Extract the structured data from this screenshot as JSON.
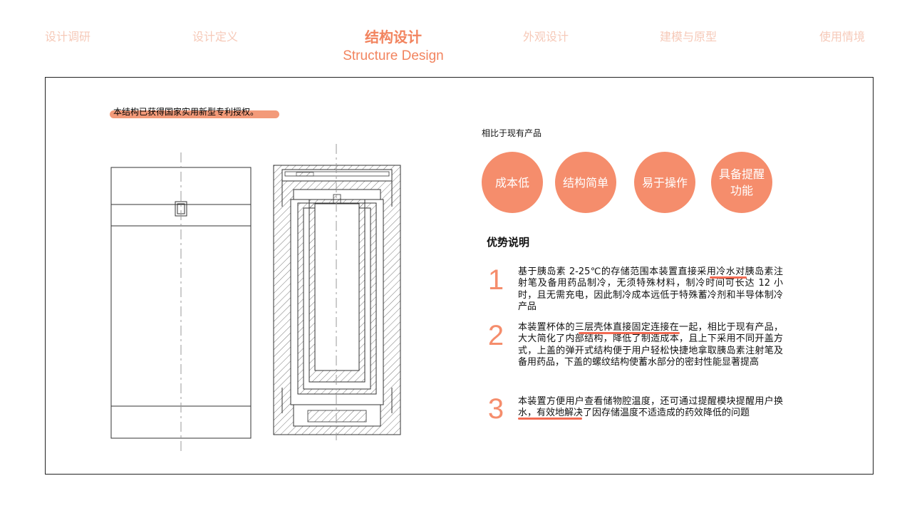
{
  "nav": {
    "items": [
      "设计调研",
      "设计定义",
      "外观设计",
      "建模与原型",
      "使用情境"
    ],
    "active_zh": "结构设计",
    "active_en": "Structure Design"
  },
  "patent_note": "本结构已获得国家实用新型专利授权。",
  "compare_title": "相比于现有产品",
  "features": [
    "成本低",
    "结构简单",
    "易于操作",
    "具备提醒功能"
  ],
  "advantages_title": "优势说明",
  "advantages": [
    {
      "num": "1",
      "text": "基于胰岛素 2-25℃的存储范围本装置直接采用冷水对胰岛素注射笔及备用药品制冷，无须特殊材料，制冷时间可长达 12 小时，且无需充电，因此制冷成本远低于特殊蓄冷剂和半导体制冷产品"
    },
    {
      "num": "2",
      "text": "本装置杯体的三层壳体直接固定连接在一起，相比于现有产品，大大简化了内部结构，降低了制造成本，且上下采用不同开盖方式，上盖的弹开式结构便于用户轻松快捷地拿取胰岛素注射笔及备用药品，下盖的螺纹结构使蓄水部分的密封性能显著提高"
    },
    {
      "num": "3",
      "text": "本装置方便用户查看储物腔温度，还可通过提醒模块提醒用户换水，有效地解决了因存储温度不适造成的药效降低的问题"
    }
  ],
  "colors": {
    "accent": "#f58d6c",
    "nav_inactive": "#f6c9b8",
    "highlight": "#f26a52"
  }
}
